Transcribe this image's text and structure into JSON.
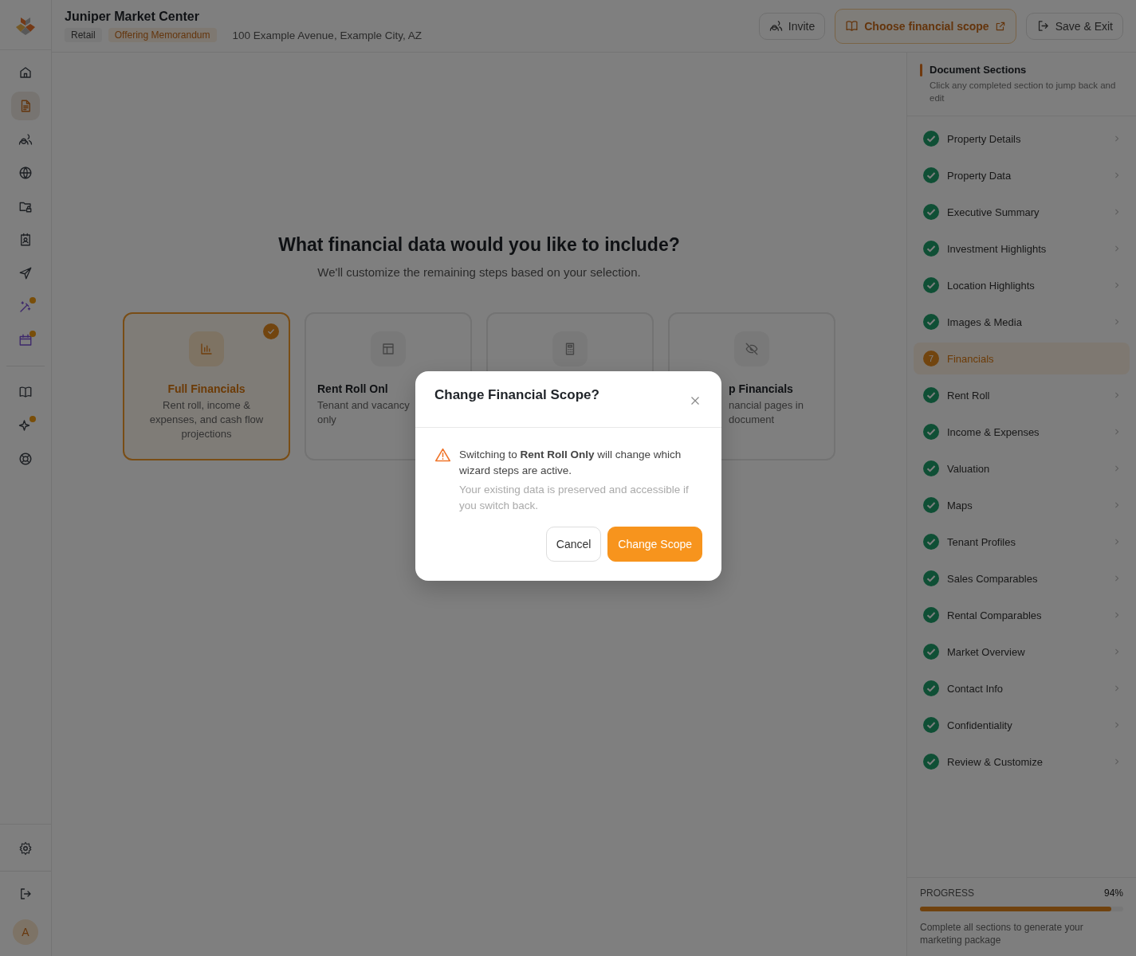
{
  "header": {
    "title": "Juniper Market Center",
    "tags": [
      {
        "label": "Retail",
        "kind": "plain"
      },
      {
        "label": "Offering Memorandum",
        "kind": "accent"
      }
    ],
    "address": "100 Example Avenue, Example City, AZ",
    "buttons": [
      {
        "label": "Invite",
        "kind": "invite"
      },
      {
        "label": "Choose financial scope",
        "kind": "scope"
      },
      {
        "label": "Save & Exit",
        "kind": "exit"
      }
    ]
  },
  "rail": {
    "items": [
      {
        "selected": false
      },
      {
        "selected": true
      },
      {
        "selected": false
      },
      {
        "selected": false
      },
      {
        "selected": false
      },
      {
        "selected": false
      },
      {
        "selected": false
      },
      {
        "selected": false
      },
      {
        "selected": false
      },
      {
        "selected": false
      },
      {
        "selected": false
      },
      {
        "selected": false
      }
    ],
    "avatar": "A"
  },
  "main": {
    "heading": "What financial data would you like to include?",
    "subheading": "We'll customize the remaining steps based on your selection.",
    "cards": [
      {
        "selected": true,
        "title": "Full Financials",
        "lines": [
          "Rent roll, income &",
          "expenses, and cash flow",
          "projections"
        ]
      },
      {
        "selected": false,
        "title": "Rent Roll Onl",
        "lines": [
          "Tenant and vacancy",
          "only"
        ]
      },
      {
        "selected": false
      },
      {
        "selected": false,
        "title": "p Financials",
        "lines": [
          "nancial pages in",
          "document"
        ]
      }
    ]
  },
  "sections": {
    "title": "Document Sections",
    "hint": "Click any completed section to jump back and edit",
    "items": [
      {
        "label": "Property Details",
        "selected": false
      },
      {
        "label": "Property Data",
        "selected": false
      },
      {
        "label": "Executive Summary",
        "selected": false
      },
      {
        "label": "Investment Highlights",
        "selected": false
      },
      {
        "label": "Location Highlights",
        "selected": false
      },
      {
        "label": "Images & Media",
        "selected": false
      },
      {
        "label": "Financials",
        "selected": true,
        "step": "7"
      },
      {
        "label": "Rent Roll",
        "selected": false
      },
      {
        "label": "Income & Expenses",
        "selected": false
      },
      {
        "label": "Valuation",
        "selected": false
      },
      {
        "label": "Maps",
        "selected": false
      },
      {
        "label": "Tenant Profiles",
        "selected": false
      },
      {
        "label": "Sales Comparables",
        "selected": false
      },
      {
        "label": "Rental Comparables",
        "selected": false
      },
      {
        "label": "Market Overview",
        "selected": false
      },
      {
        "label": "Contact Info",
        "selected": false
      },
      {
        "label": "Confidentiality",
        "selected": false
      },
      {
        "label": "Review & Customize",
        "selected": false
      }
    ],
    "progress": {
      "label": "PROGRESS",
      "value": "94%",
      "level": 0.94,
      "note": "Complete all sections to generate your marketing package"
    }
  },
  "dialog": {
    "title": "Change Financial Scope?",
    "message": "Switching to **Rent Roll Only** will change which wizard steps are active.",
    "note": "Your existing data is preserved and accessible if you switch back.",
    "buttons": [
      {
        "label": "Cancel",
        "kind": "secondary"
      },
      {
        "label": "Change Scope",
        "kind": "primary"
      }
    ]
  }
}
